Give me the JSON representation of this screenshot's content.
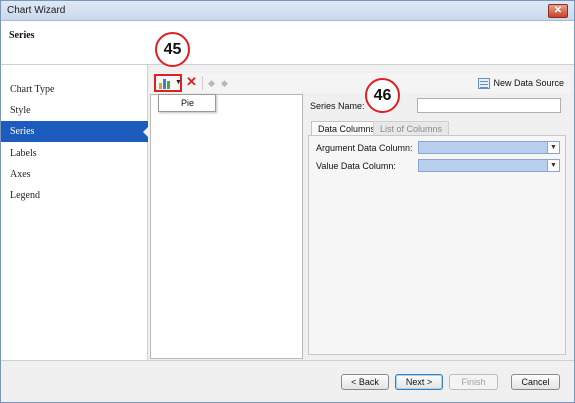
{
  "window": {
    "title": "Chart Wizard",
    "close_glyph": "✕"
  },
  "header": {
    "heading": "Series"
  },
  "sidebar": {
    "items": [
      {
        "label": "Chart Type"
      },
      {
        "label": "Style"
      },
      {
        "label": "Series",
        "active": true
      },
      {
        "label": "Labels"
      },
      {
        "label": "Axes"
      },
      {
        "label": "Legend"
      }
    ]
  },
  "toolbar": {
    "add_series_icon": "bar-chart-icon",
    "delete_glyph": "✕",
    "move_up_glyph": "◆",
    "move_down_glyph": "◆",
    "new_data_source_label": "New Data Source"
  },
  "dropdown": {
    "items": [
      "Pie"
    ]
  },
  "properties": {
    "series_name_label": "Series Name:",
    "series_name_value": "",
    "tabs": [
      "Data Columns",
      "List of Columns"
    ],
    "argument_column_label": "Argument Data Column:",
    "value_column_label": "Value Data Column:"
  },
  "footer": {
    "back_label": "< Back",
    "next_label": "Next >",
    "finish_label": "Finish",
    "cancel_label": "Cancel"
  },
  "callouts": {
    "a": "45",
    "b": "46"
  },
  "colors": {
    "selection": "#1b5cbd",
    "callout_red": "#e02020",
    "combo_fill": "#b9cff0"
  }
}
